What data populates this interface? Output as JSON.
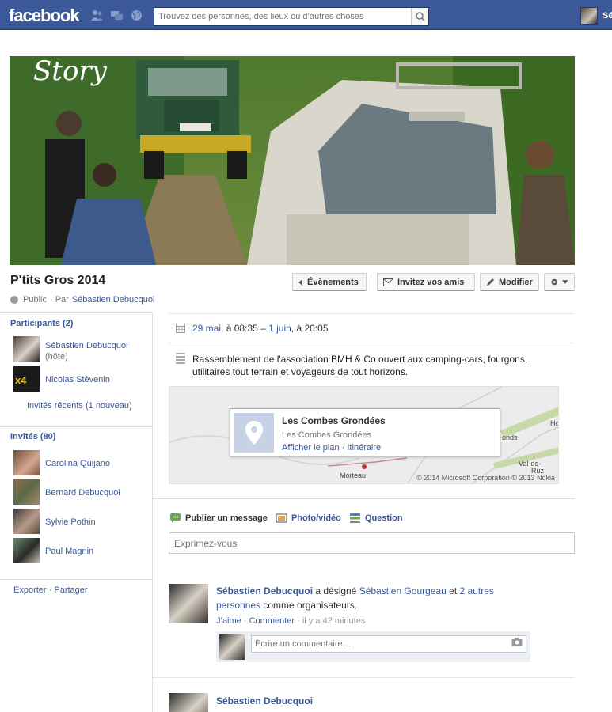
{
  "topbar": {
    "logo": "facebook",
    "search_placeholder": "Trouvez des personnes, des lieux ou d’autres choses",
    "user_name": "Sé"
  },
  "cover": {
    "overlay_text": "Story"
  },
  "event": {
    "title": "P'tits Gros 2014",
    "privacy": "Public",
    "by_prefix": "· Par",
    "host": "Sébastien Debucquoi"
  },
  "actions": {
    "events": "Évènements",
    "invite": "Invitez vos amis",
    "edit": "Modifier"
  },
  "participants": {
    "title": "Participants (2)",
    "people": [
      {
        "name": "Sébastien Debucquoi",
        "note": "(hôte)"
      },
      {
        "name": "Nicolas Stèvenin"
      }
    ],
    "recent": "Invités récents (1 nouveau)"
  },
  "invited": {
    "title": "Invités (80)",
    "people": [
      {
        "name": "Carolina Quijano"
      },
      {
        "name": "Bernard Debucquoi"
      },
      {
        "name": "Sylvie Pothin"
      },
      {
        "name": "Paul Magnin"
      }
    ]
  },
  "left_footer": {
    "export": "Exporter",
    "dot": "·",
    "share": "Partager"
  },
  "details": {
    "date_start": "29 mai",
    "time_start": ", à 08:35",
    "dash": " – ",
    "date_end": "1 juin",
    "time_end": ", à 20:05",
    "description": "Rassemblement de l'association BMH & Co ouvert aux camping-cars, fourgons, utilitaires tout terrain et voyageurs de tout horizons."
  },
  "map": {
    "place_title": "Les Combes Grondées",
    "place_sub": "Les Combes Grondées",
    "show_map": "Afficher le plan",
    "dot": " · ",
    "route": "Itinéraire",
    "town_morteau": "Morteau",
    "town_onds": "onds",
    "town_ho": "Ho",
    "town_valde": "Val-de-",
    "town_ruz": "Ruz",
    "copyright": "© 2014 Microsoft Corporation © 2013 Nokia"
  },
  "composer": {
    "publish": "Publier un message",
    "photo": "Photo/vidéo",
    "question": "Question",
    "placeholder": "Exprimez-vous"
  },
  "stories": [
    {
      "author": "Sébastien Debucquoi",
      "text_1": " a désigné ",
      "tagged": "Sébastien Gourgeau",
      "text_2": " et ",
      "others": "2 autres personnes",
      "text_3": " comme organisateurs.",
      "like": "J’aime",
      "comment": "Commenter",
      "time": " · il y a 42 minutes",
      "comment_placeholder": "Écrire un commentaire…"
    },
    {
      "author": "Sébastien Debucquoi"
    }
  ],
  "colors": {
    "brand": "#3b5998",
    "link": "#3b5998"
  }
}
